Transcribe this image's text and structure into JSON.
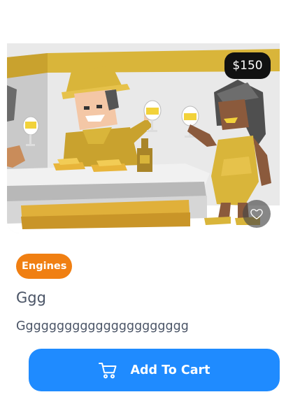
{
  "product": {
    "price": "$150",
    "category": "Engines",
    "title": "Ggg",
    "description": "Gggggggggggggggggggggg"
  },
  "actions": {
    "add_to_cart_label": "Add To Cart",
    "favorite_icon": "heart-outline-icon",
    "cart_icon": "shopping-cart-icon"
  },
  "colors": {
    "accent": "#1f8bff",
    "category_badge": "#f07f12",
    "price_badge": "#111111",
    "text": "#4a5466"
  },
  "image": {
    "description": "illustration-bar-scene"
  }
}
